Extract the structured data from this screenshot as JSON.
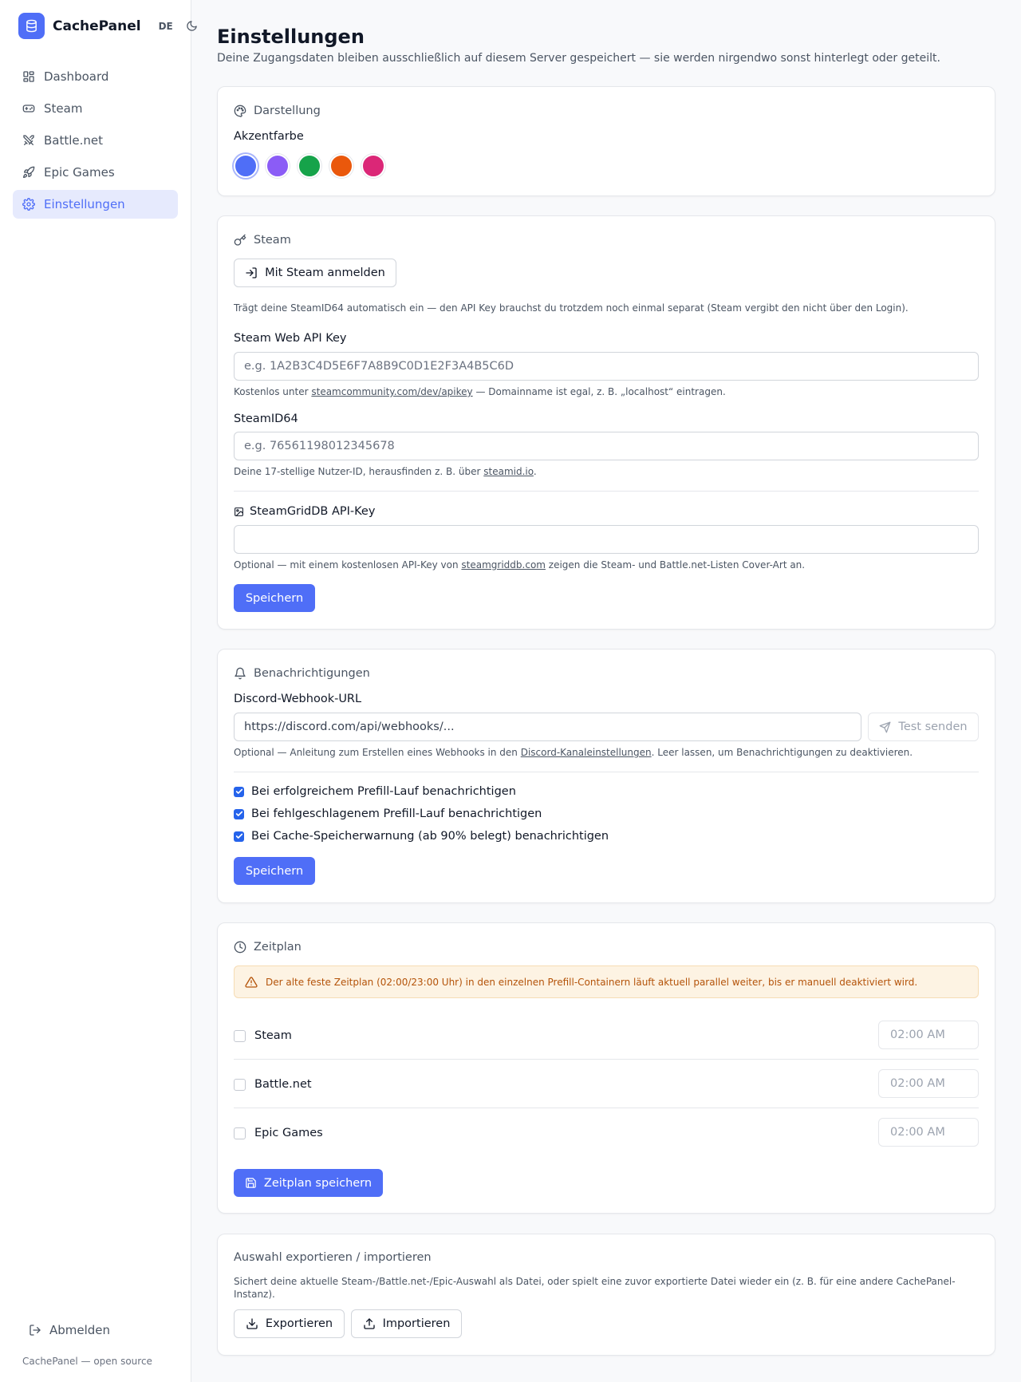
{
  "app": {
    "name": "CachePanel",
    "lang": "DE",
    "footer": "CachePanel — open source",
    "logout": "Abmelden"
  },
  "nav": {
    "items": [
      {
        "label": "Dashboard",
        "icon": "dashboard-icon"
      },
      {
        "label": "Steam",
        "icon": "gamepad-icon"
      },
      {
        "label": "Battle.net",
        "icon": "swords-icon"
      },
      {
        "label": "Epic Games",
        "icon": "rocket-icon"
      },
      {
        "label": "Einstellungen",
        "icon": "gear-icon",
        "active": true
      }
    ]
  },
  "page": {
    "title": "Einstellungen",
    "subtitle": "Deine Zugangsdaten bleiben ausschließlich auf diesem Server gespeichert — sie werden nirgendwo sonst hinterlegt oder geteilt."
  },
  "appearance": {
    "heading": "Darstellung",
    "accent_label": "Akzentfarbe",
    "colors": [
      "#4f6ef7",
      "#8b5cf6",
      "#16a34a",
      "#ea580c",
      "#db2777"
    ],
    "selected_color": "#4f6ef7"
  },
  "steam": {
    "heading": "Steam",
    "login_button": "Mit Steam anmelden",
    "login_hint": "Trägt deine SteamID64 automatisch ein — den API Key brauchst du trotzdem noch einmal separat (Steam vergibt den nicht über den Login).",
    "api_key_label": "Steam Web API Key",
    "api_key_placeholder": "e.g. 1A2B3C4D5E6F7A8B9C0D1E2F3A4B5C6D",
    "api_hint_pre": "Kostenlos unter ",
    "api_hint_link": "steamcommunity.com/dev/apikey",
    "api_hint_post": " — Domainname ist egal, z. B. „localhost“ eintragen.",
    "steamid_label": "SteamID64",
    "steamid_placeholder": "e.g. 76561198012345678",
    "steamid_hint_pre": "Deine 17-stellige Nutzer-ID, herausfinden z. B. über ",
    "steamid_hint_link": "steamid.io",
    "steamid_hint_post": ".",
    "grid_label": "SteamGridDB API-Key",
    "grid_value": "",
    "grid_hint_pre": "Optional — mit einem kostenlosen API-Key von ",
    "grid_hint_link": "steamgriddb.com",
    "grid_hint_post": " zeigen die Steam- und Battle.net-Listen Cover-Art an.",
    "save": "Speichern"
  },
  "notifications": {
    "heading": "Benachrichtigungen",
    "webhook_label": "Discord-Webhook-URL",
    "webhook_placeholder": "https://discord.com/api/webhooks/...",
    "test_button": "Test senden",
    "hint_pre": "Optional — Anleitung zum Erstellen eines Webhooks in den ",
    "hint_link": "Discord-Kanaleinstellungen",
    "hint_post": ". Leer lassen, um Benachrichtigungen zu deaktivieren.",
    "options": [
      {
        "label": "Bei erfolgreichem Prefill-Lauf benachrichtigen",
        "checked": true
      },
      {
        "label": "Bei fehlgeschlagenem Prefill-Lauf benachrichtigen",
        "checked": true
      },
      {
        "label": "Bei Cache-Speicherwarnung (ab 90% belegt) benachrichtigen",
        "checked": true
      }
    ],
    "save": "Speichern"
  },
  "schedule": {
    "heading": "Zeitplan",
    "warning": "Der alte feste Zeitplan (02:00/23:00 Uhr) in den einzelnen Prefill-Containern läuft aktuell parallel weiter, bis er manuell deaktiviert wird.",
    "rows": [
      {
        "label": "Steam",
        "time": "02:00 AM",
        "checked": false
      },
      {
        "label": "Battle.net",
        "time": "02:00 AM",
        "checked": false
      },
      {
        "label": "Epic Games",
        "time": "02:00 AM",
        "checked": false
      }
    ],
    "save": "Zeitplan speichern"
  },
  "export": {
    "heading": "Auswahl exportieren / importieren",
    "text": "Sichert deine aktuelle Steam-/Battle.net-/Epic-Auswahl als Datei, oder spielt eine zuvor exportierte Datei wieder ein (z. B. für eine andere CachePanel-Instanz).",
    "export_button": "Exportieren",
    "import_button": "Importieren"
  }
}
